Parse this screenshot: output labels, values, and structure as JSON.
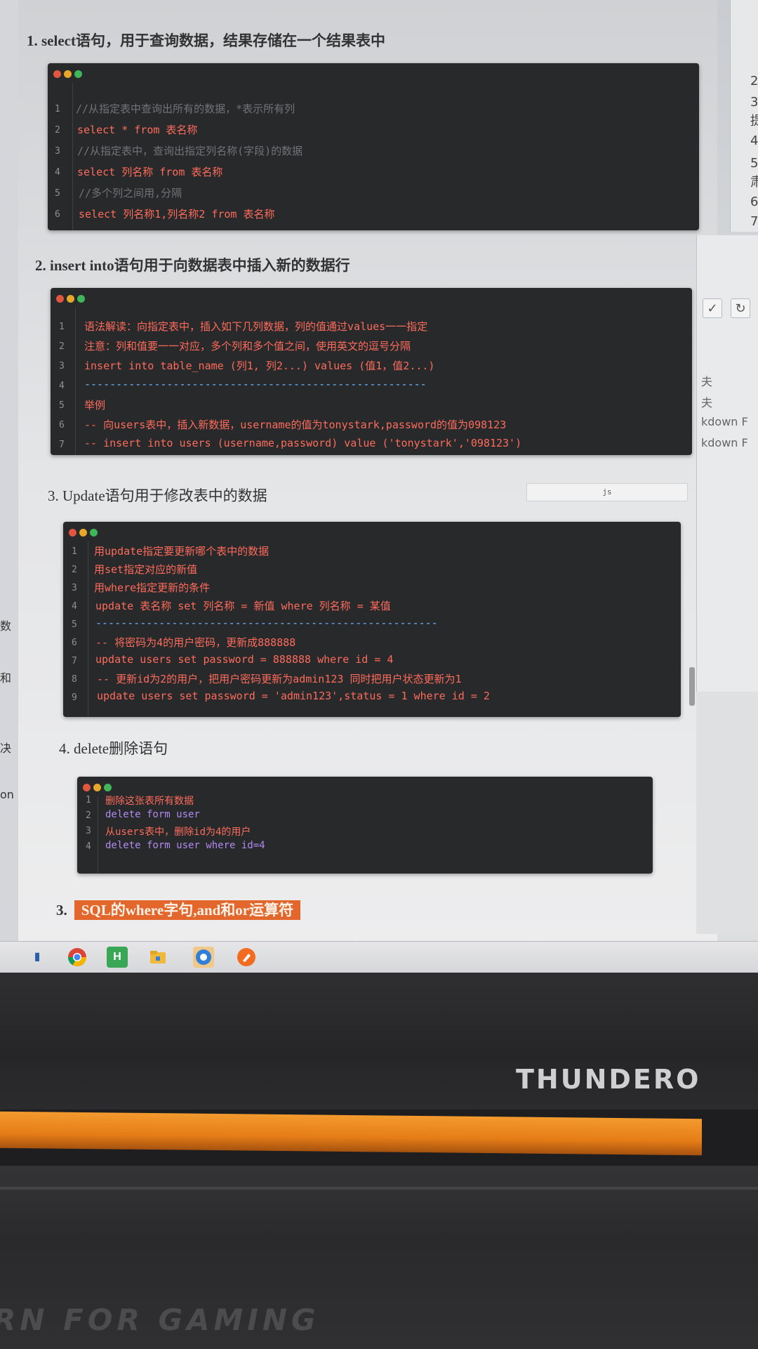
{
  "left_fragments": [
    "数",
    "和",
    "决",
    "on"
  ],
  "right_numbers": [
    "2",
    "3",
    "提",
    "4",
    "5",
    "肃",
    "6",
    "7."
  ],
  "right_panel_items": [
    "夫",
    "夫",
    "kdown F",
    "kdown F"
  ],
  "right_tools": [
    "✓",
    "↻"
  ],
  "sections": {
    "s1": {
      "num": "1.",
      "title": "select语句，用于查询数据，结果存储在一个结果表中"
    },
    "s2": {
      "num": "2.",
      "title": "insert into语句用于向数据表中插入新的数据行"
    },
    "s3": {
      "num": "3.",
      "title": "Update语句用于修改表中的数据"
    },
    "s4": {
      "num": "4.",
      "title": "delete删除语句"
    },
    "s5": {
      "num": "3.",
      "title": "SQL的where字句,and和or运算符"
    }
  },
  "js_badge": "js",
  "code1": [
    "//从指定表中查询出所有的数据，*表示所有列",
    "select * from 表名称",
    "//从指定表中，查询出指定列名称(字段)的数据",
    "select 列名称 from 表名称",
    "//多个列之间用,分隔",
    "select 列名称1,列名称2 from 表名称"
  ],
  "code2": [
    "语法解读：向指定表中，插入如下几列数据，列的值通过values一一指定",
    "注意：列和值要一一对应，多个列和多个值之间，使用英文的逗号分隔",
    "insert into table_name (列1, 列2...) values (值1，值2...)",
    "------------------------------------------------------",
    "举例",
    "-- 向users表中，插入新数据，username的值为tonystark,password的值为098123",
    "-- insert into users (username,password) value ('tonystark','098123')"
  ],
  "code3": [
    "用update指定要更新哪个表中的数据",
    "用set指定对应的新值",
    "用where指定更新的条件",
    "update 表名称 set 列名称 = 新值 where 列名称 = 某值",
    "------------------------------------------------------",
    "-- 将密码为4的用户密码，更新成888888",
    "update users set password = 888888 where id = 4",
    "-- 更新id为2的用户，把用户密码更新为admin123 同时把用户状态更新为1",
    "update users set password = 'admin123',status = 1 where id = 2"
  ],
  "code4": [
    "删除这张表所有数据",
    "delete form user",
    "从users表中，删除id为4的用户",
    "delete form user where id=4"
  ],
  "line_numbers": [
    "1",
    "2",
    "3",
    "4",
    "5",
    "6",
    "7",
    "8",
    "9"
  ],
  "taskbar_icons": [
    "file-explorer-blue-icon",
    "chrome-icon",
    "hbuilder-icon",
    "folder-icon",
    "gear-app-icon",
    "pen-app-icon"
  ],
  "taskbar_labels": {
    "hbuilder": "H"
  },
  "brand": "THUNDERO",
  "slogan": "RN FOR GAMING",
  "colors": {
    "code_bg": "#27292b",
    "keyword_red": "#ff6b5b",
    "string_green": "#c6e76a",
    "heading_highlight": "#e3662d",
    "laptop_orange": "#f0901f"
  }
}
